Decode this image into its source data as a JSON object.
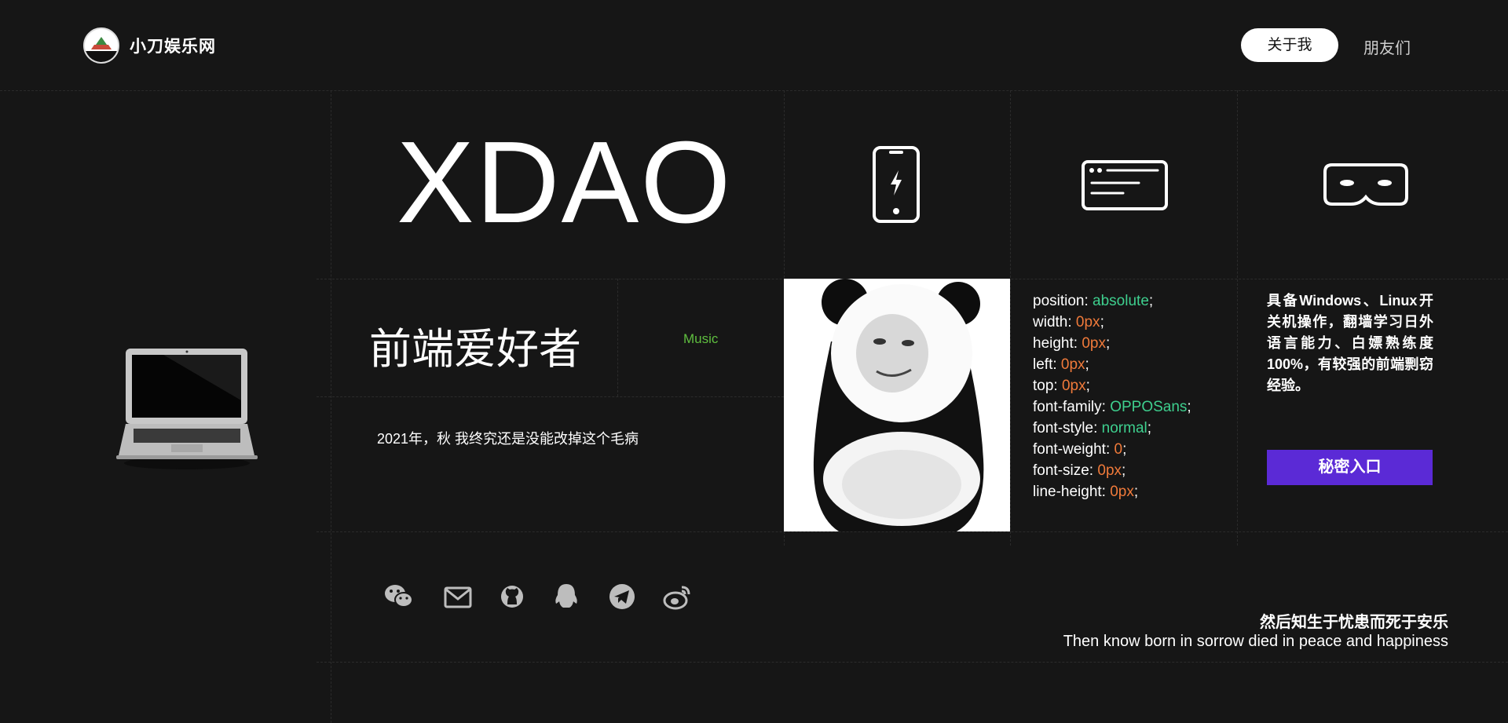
{
  "header": {
    "brand": "小刀娱乐网",
    "nav": {
      "about": "关于我",
      "friends": "朋友们"
    }
  },
  "hero": {
    "title": "XDAO",
    "subtitle": "前端爱好者",
    "music": "Music",
    "motto": "2021年，秋 我终究还是没能改掉这个毛病"
  },
  "icons": {
    "phone": "phone-icon",
    "browser": "browser-window-icon",
    "vr": "vr-headset-icon",
    "laptop": "laptop-icon"
  },
  "css_props": [
    {
      "prop": "position: ",
      "val": "absolute",
      "color": "green"
    },
    {
      "prop": "width: ",
      "val": "0px",
      "color": "orange"
    },
    {
      "prop": "height: ",
      "val": "0px",
      "color": "orange"
    },
    {
      "prop": "left: ",
      "val": "0px",
      "color": "orange"
    },
    {
      "prop": "top: ",
      "val": "0px",
      "color": "orange"
    },
    {
      "prop": "font-family: ",
      "val": "OPPOSans",
      "color": "green"
    },
    {
      "prop": "font-style: ",
      "val": "normal",
      "color": "green"
    },
    {
      "prop": "font-weight: ",
      "val": "0",
      "color": "orange"
    },
    {
      "prop": "font-size: ",
      "val": "0px",
      "color": "orange"
    },
    {
      "prop": "line-height: ",
      "val": "0px",
      "color": "orange"
    }
  ],
  "skills": {
    "text": "具备Windows、Linux开关机操作，翻墙学习日外语言能力、白嫖熟练度100%，有较强的前端剽窃经验。",
    "button": "秘密入口"
  },
  "social": [
    "wechat-icon",
    "mail-icon",
    "github-icon",
    "qq-icon",
    "telegram-icon",
    "weibo-icon"
  ],
  "quote": {
    "cn": "然后知生于忧患而死于安乐",
    "en": "Then know born in sorrow died in peace and happiness"
  },
  "colors": {
    "accent": "#5b2ad6",
    "music": "#5fbf3f",
    "css_green": "#3ecf8e",
    "css_orange": "#f07a3a"
  }
}
